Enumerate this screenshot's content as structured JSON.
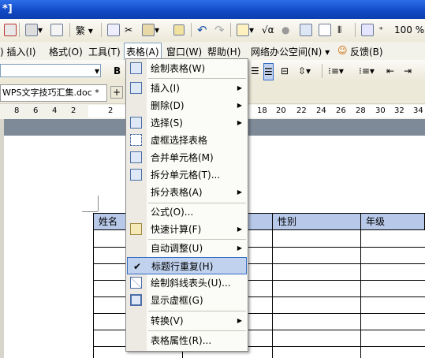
{
  "title_bar": {
    "text": "*]"
  },
  "toolbar": {
    "zoom": "100 %"
  },
  "menubar": {
    "items": [
      {
        "label": ") 插入(I)"
      },
      {
        "label": "格式(O)"
      },
      {
        "label": "工具(T)"
      },
      {
        "label": "表格(A)"
      },
      {
        "label": "窗口(W)"
      },
      {
        "label": "帮助(H)"
      },
      {
        "label": "网络办公空间(N) ▾"
      },
      {
        "label": "反馈(B)"
      }
    ]
  },
  "tabs": {
    "doc": "WPS文字技巧汇集.doc *"
  },
  "ruler": {
    "left_ticks": [
      "8",
      "6",
      "4",
      "2"
    ],
    "marks": [
      "2",
      "18",
      "20",
      "22",
      "24",
      "26",
      "28",
      "30",
      "32",
      "34"
    ]
  },
  "table": {
    "headers": [
      "姓名",
      "",
      "性别",
      "年级"
    ]
  },
  "table_menu": {
    "items": [
      {
        "label": "绘制表格(W)",
        "icon": "draw-table-icon",
        "arrow": false
      },
      {
        "label": "插入(I)",
        "icon": "insert-icon",
        "arrow": true
      },
      {
        "label": "删除(D)",
        "icon": "",
        "arrow": true
      },
      {
        "label": "选择(S)",
        "icon": "select-table-icon",
        "arrow": true
      },
      {
        "label": "虚框选择表格",
        "icon": "dashed-select-icon",
        "arrow": false
      },
      {
        "label": "合并单元格(M)",
        "icon": "merge-cells-icon",
        "arrow": false
      },
      {
        "label": "拆分单元格(T)...",
        "icon": "split-cells-icon",
        "arrow": false
      },
      {
        "label": "拆分表格(A)",
        "icon": "",
        "arrow": true
      },
      {
        "label": "公式(O)...",
        "icon": "",
        "arrow": false
      },
      {
        "label": "快速计算(F)",
        "icon": "quick-calc-icon",
        "arrow": true
      },
      {
        "label": "自动调整(U)",
        "icon": "",
        "arrow": true
      },
      {
        "label": "标题行重复(H)",
        "icon": "checkmark-icon",
        "arrow": false
      },
      {
        "label": "绘制斜线表头(U)...",
        "icon": "diagonal-header-icon",
        "arrow": false
      },
      {
        "label": "显示虚框(G)",
        "icon": "show-gridlines-icon",
        "arrow": false
      },
      {
        "label": "转换(V)",
        "icon": "",
        "arrow": true
      },
      {
        "label": "表格属性(R)...",
        "icon": "",
        "arrow": false
      }
    ]
  }
}
